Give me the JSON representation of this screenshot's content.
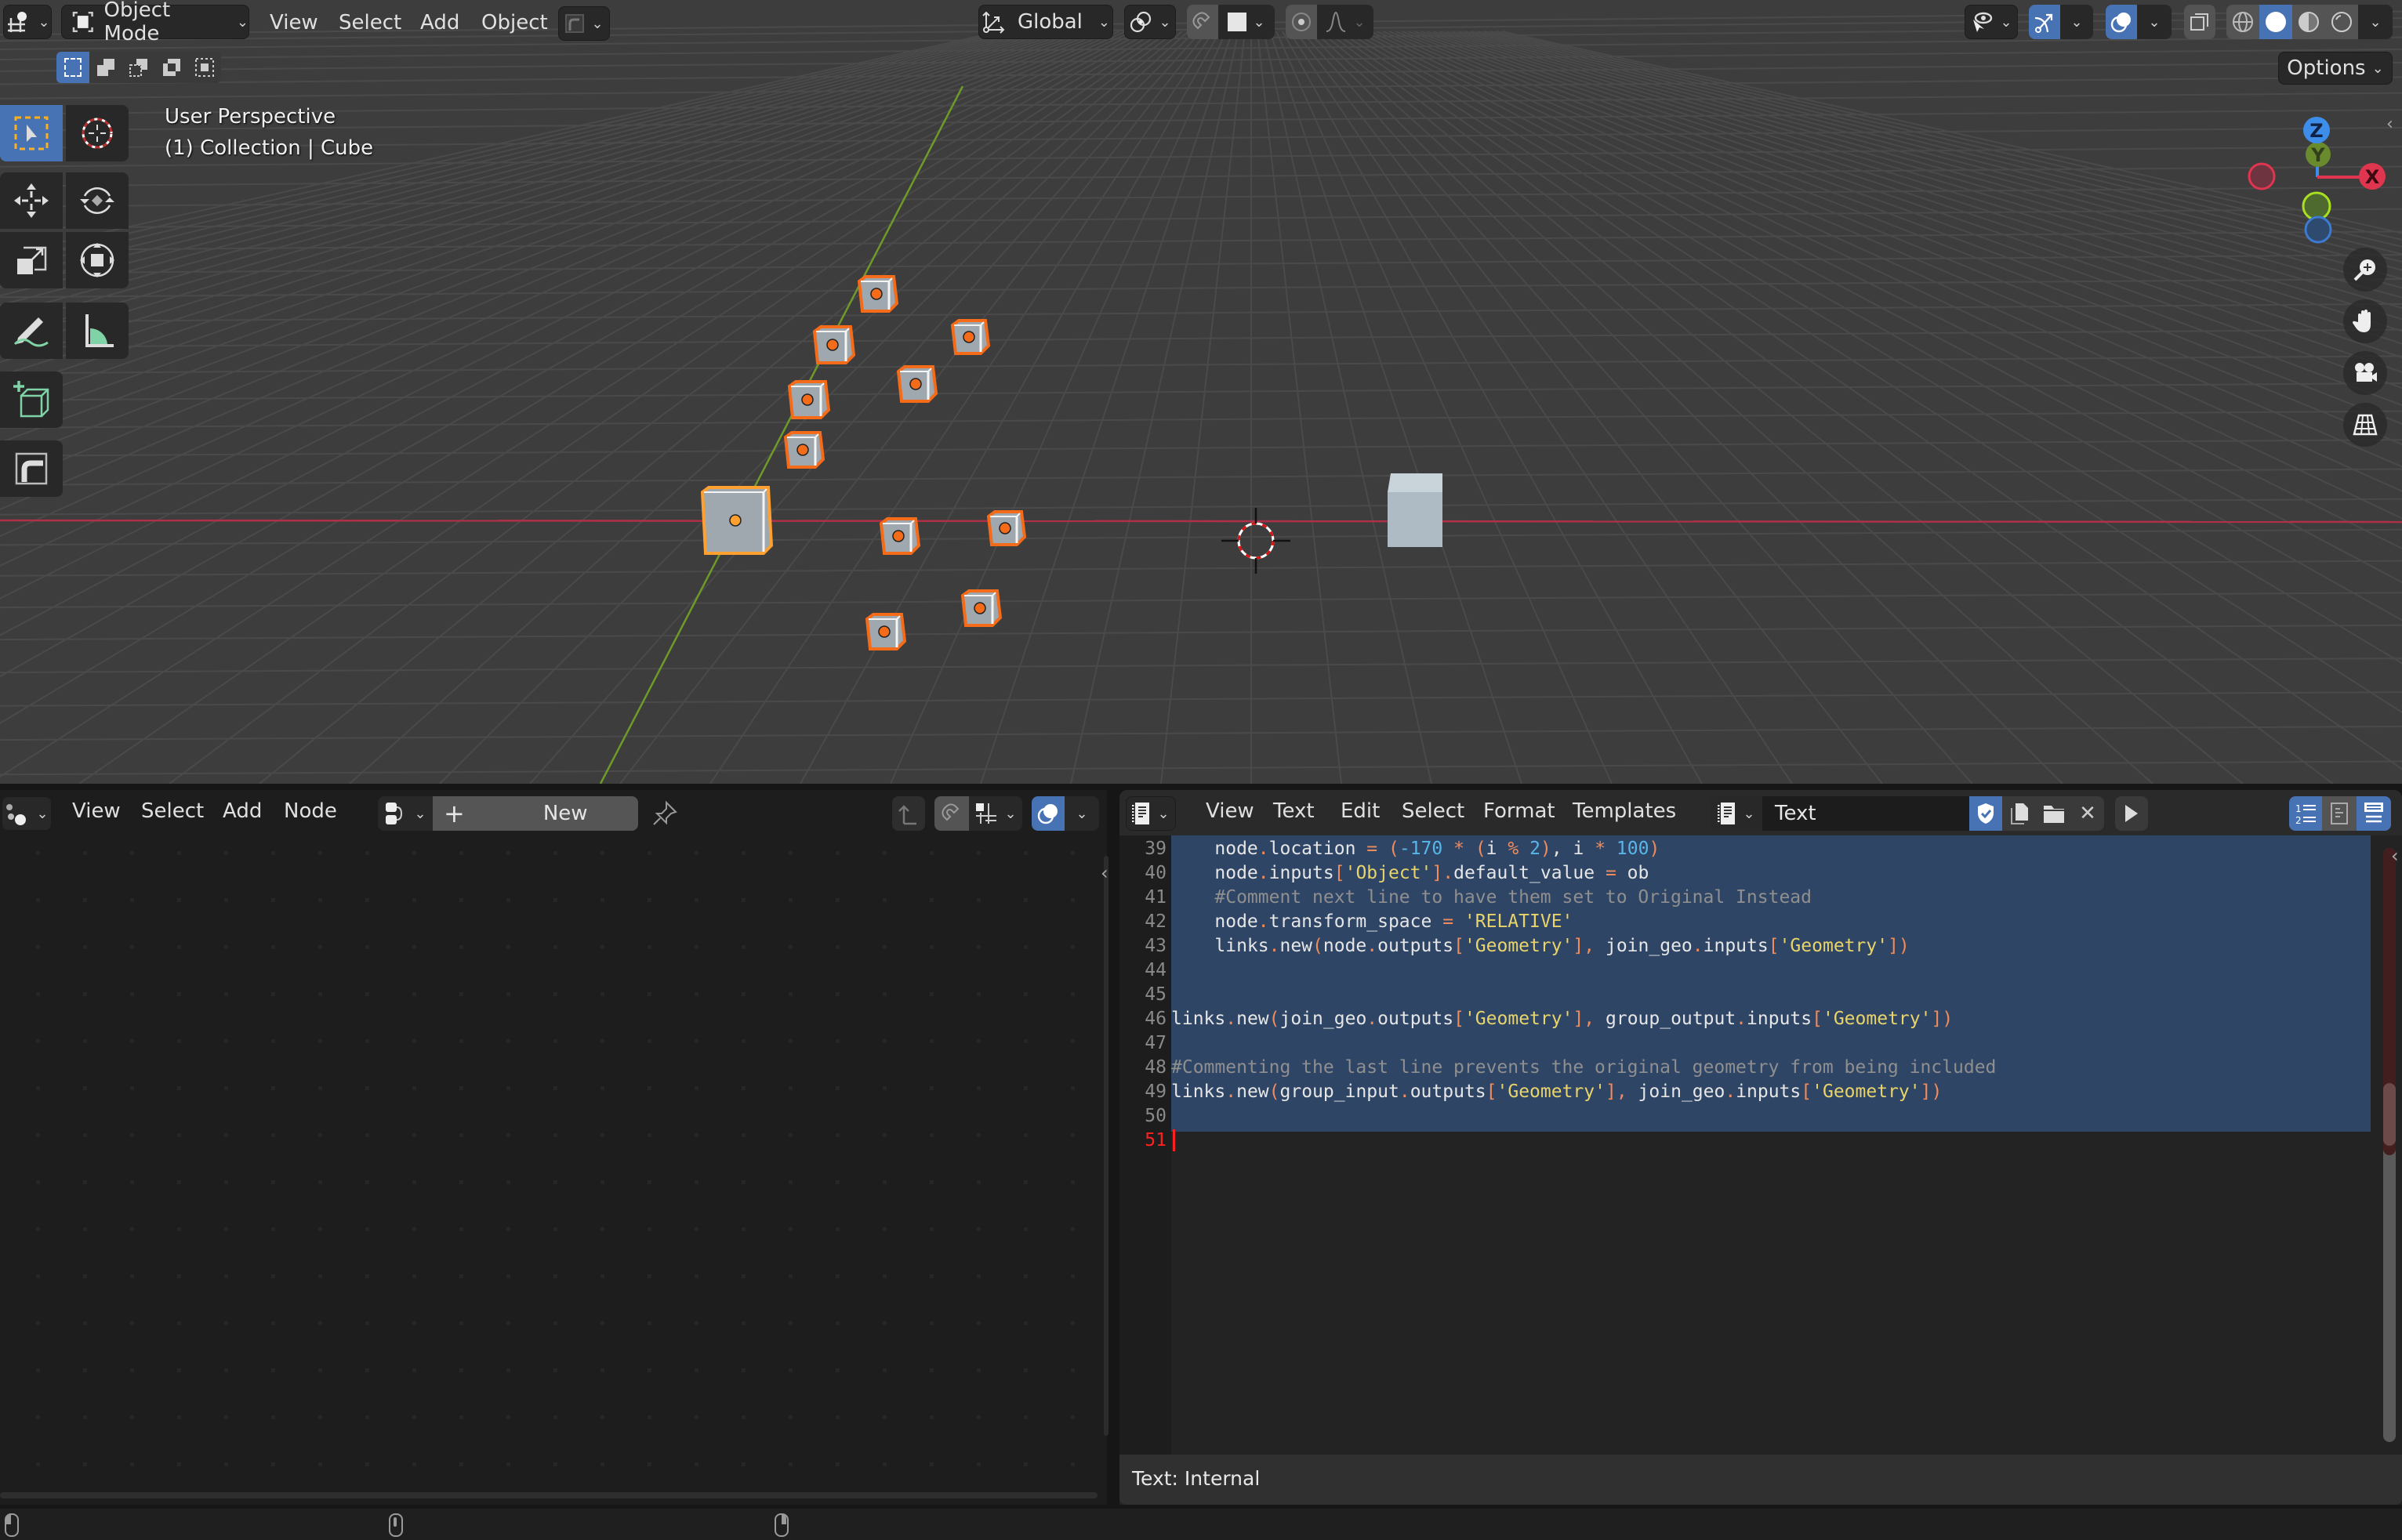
{
  "viewport_header": {
    "editor_type_icon": "3d-viewport-icon",
    "mode": "Object Mode",
    "menus": [
      "View",
      "Select",
      "Add",
      "Object"
    ],
    "transform_orientation": "Global",
    "options_label": "Options",
    "selection_modes": [
      "set-new",
      "extend",
      "subtract",
      "invert",
      "intersect"
    ],
    "shading_modes": [
      "wireframe",
      "solid",
      "material-preview",
      "rendered"
    ],
    "active_shading": "solid"
  },
  "viewport_overlay": {
    "view_name": "User Perspective",
    "collection_info": "(1) Collection | Cube"
  },
  "toolbar": {
    "tools": [
      "select-box",
      "cursor",
      "move",
      "rotate",
      "scale",
      "transform",
      "annotate",
      "measure",
      "add-cube",
      "extrude"
    ],
    "active_tool": "select-box"
  },
  "gizmo": {
    "axes": [
      "Z",
      "Y",
      "X"
    ]
  },
  "nav_buttons": [
    "zoom",
    "pan",
    "camera",
    "toggle-perspective"
  ],
  "colors": {
    "accent": "#4772b3",
    "selected_outline": "#f46b1a",
    "active_outline": "#ffa030",
    "x_axis": "#e0354f",
    "y_axis": "#8bc03c",
    "z_axis": "#3d8eea",
    "selection_highlight": "#2e4566"
  },
  "node_editor": {
    "editor_type_icon": "node-editor-icon",
    "menus": [
      "View",
      "Select",
      "Add",
      "Node"
    ],
    "new_button": "New",
    "new_button_plus": "+"
  },
  "text_editor": {
    "editor_type_icon": "text-editor-icon",
    "menus": [
      "View",
      "Text",
      "Edit",
      "Select",
      "Format",
      "Templates"
    ],
    "text_name": "Text",
    "footer": "Text: Internal",
    "lines": [
      {
        "num": "39",
        "tokens": [
          [
            "",
            "    node"
          ],
          [
            "op",
            "."
          ],
          [
            "",
            "location "
          ],
          [
            "op",
            "="
          ],
          [
            "",
            " "
          ],
          [
            "op",
            "("
          ],
          [
            "num",
            "-170"
          ],
          [
            "",
            " "
          ],
          [
            "op",
            "*"
          ],
          [
            "",
            " "
          ],
          [
            "op",
            "("
          ],
          [
            "",
            "i "
          ],
          [
            "op",
            "%"
          ],
          [
            "",
            " "
          ],
          [
            "num",
            "2"
          ],
          [
            "op",
            ")"
          ],
          [
            "",
            ", i "
          ],
          [
            "op",
            "*"
          ],
          [
            "",
            " "
          ],
          [
            "num",
            "100"
          ],
          [
            "op",
            ")"
          ]
        ]
      },
      {
        "num": "40",
        "tokens": [
          [
            "",
            "    node"
          ],
          [
            "op",
            "."
          ],
          [
            "",
            "inputs"
          ],
          [
            "op",
            "["
          ],
          [
            "str",
            "'Object'"
          ],
          [
            "op",
            "]"
          ],
          [
            "op",
            "."
          ],
          [
            "",
            "default_value "
          ],
          [
            "op",
            "="
          ],
          [
            "",
            " ob"
          ]
        ]
      },
      {
        "num": "41",
        "tokens": [
          [
            "cmt",
            "    #Comment next line to have them set to Original Instead"
          ]
        ]
      },
      {
        "num": "42",
        "tokens": [
          [
            "",
            "    node"
          ],
          [
            "op",
            "."
          ],
          [
            "",
            "transform_space "
          ],
          [
            "op",
            "="
          ],
          [
            "",
            " "
          ],
          [
            "str",
            "'RELATIVE'"
          ]
        ]
      },
      {
        "num": "43",
        "tokens": [
          [
            "",
            "    links"
          ],
          [
            "op",
            "."
          ],
          [
            "",
            "new"
          ],
          [
            "op",
            "("
          ],
          [
            "",
            "node"
          ],
          [
            "op",
            "."
          ],
          [
            "",
            "outputs"
          ],
          [
            "op",
            "["
          ],
          [
            "str",
            "'Geometry'"
          ],
          [
            "op",
            "]"
          ],
          [
            "op",
            ","
          ],
          [
            "",
            " join_geo"
          ],
          [
            "op",
            "."
          ],
          [
            "",
            "inputs"
          ],
          [
            "op",
            "["
          ],
          [
            "str",
            "'Geometry'"
          ],
          [
            "op",
            "])"
          ]
        ]
      },
      {
        "num": "44",
        "tokens": []
      },
      {
        "num": "45",
        "tokens": []
      },
      {
        "num": "46",
        "tokens": [
          [
            "",
            "links"
          ],
          [
            "op",
            "."
          ],
          [
            "",
            "new"
          ],
          [
            "op",
            "("
          ],
          [
            "",
            "join_geo"
          ],
          [
            "op",
            "."
          ],
          [
            "",
            "outputs"
          ],
          [
            "op",
            "["
          ],
          [
            "str",
            "'Geometry'"
          ],
          [
            "op",
            "]"
          ],
          [
            "op",
            ","
          ],
          [
            "",
            " group_output"
          ],
          [
            "op",
            "."
          ],
          [
            "",
            "inputs"
          ],
          [
            "op",
            "["
          ],
          [
            "str",
            "'Geometry'"
          ],
          [
            "op",
            "])"
          ]
        ]
      },
      {
        "num": "47",
        "tokens": []
      },
      {
        "num": "48",
        "tokens": [
          [
            "cmt",
            "#Commenting the last line prevents the original geometry from being included"
          ]
        ]
      },
      {
        "num": "49",
        "tokens": [
          [
            "",
            "links"
          ],
          [
            "op",
            "."
          ],
          [
            "",
            "new"
          ],
          [
            "op",
            "("
          ],
          [
            "",
            "group_input"
          ],
          [
            "op",
            "."
          ],
          [
            "",
            "outputs"
          ],
          [
            "op",
            "["
          ],
          [
            "str",
            "'Geometry'"
          ],
          [
            "op",
            "]"
          ],
          [
            "op",
            ","
          ],
          [
            "",
            " join_geo"
          ],
          [
            "op",
            "."
          ],
          [
            "",
            "inputs"
          ],
          [
            "op",
            "["
          ],
          [
            "str",
            "'Geometry'"
          ],
          [
            "op",
            "])"
          ]
        ]
      },
      {
        "num": "50",
        "tokens": []
      },
      {
        "num": "51",
        "tokens": []
      }
    ],
    "current_line": "51"
  },
  "status_bar": {
    "items": [
      "mouse-left-icon",
      "mouse-middle-icon",
      "mouse-right-icon"
    ]
  }
}
